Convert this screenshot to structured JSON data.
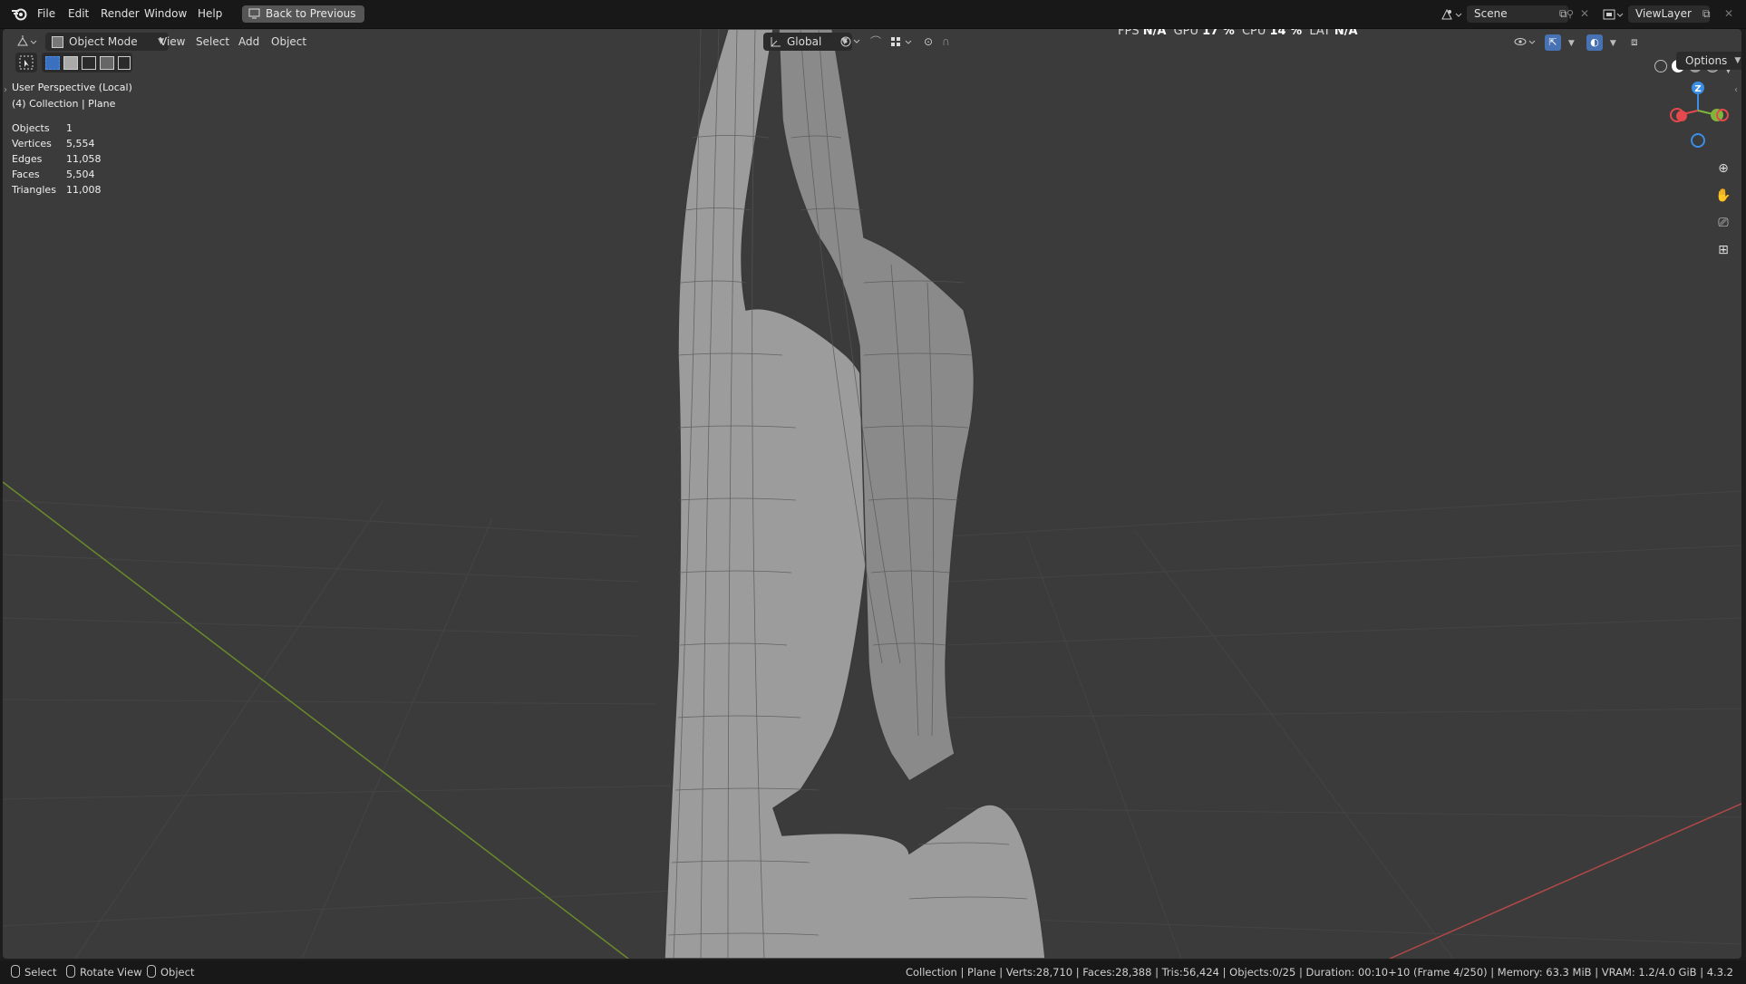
{
  "topbar": {
    "menus": [
      "File",
      "Edit",
      "Render",
      "Window",
      "Help"
    ],
    "back_label": "Back to Previous",
    "scene_value": "Scene",
    "viewlayer_value": "ViewLayer"
  },
  "viewport_header": {
    "mode_label": "Object Mode",
    "menus": [
      "View",
      "Select",
      "Add",
      "Object"
    ],
    "orientation_label": "Global",
    "options_label": "Options"
  },
  "perf": {
    "fps_label": "FPS",
    "fps_value": "N/A",
    "gpu_label": "GPU",
    "gpu_value": "17 %",
    "cpu_label": "CPU",
    "cpu_value": "14 %",
    "lat_label": "LAT",
    "lat_value": "N/A"
  },
  "overlay": {
    "view_name": "User Perspective (Local)",
    "collection": "(4) Collection | Plane",
    "stats": [
      {
        "label": "Objects",
        "value": "1"
      },
      {
        "label": "Vertices",
        "value": "5,554"
      },
      {
        "label": "Edges",
        "value": "11,058"
      },
      {
        "label": "Faces",
        "value": "5,504"
      },
      {
        "label": "Triangles",
        "value": "11,008"
      }
    ]
  },
  "gizmo": {
    "z_label": "Z",
    "x_color": "#e5484d",
    "y_color": "#7fb53b",
    "z_color": "#3a8ee6"
  },
  "statusbar": {
    "select_label": "Select",
    "rotate_label": "Rotate View",
    "object_label": "Object",
    "info": "Collection | Plane | Verts:28,710 | Faces:28,388 | Tris:56,424 | Objects:0/25 | Duration: 00:10+10 (Frame 4/250) | Memory: 63.3 MiB | VRAM: 1.2/4.0 GiB | 4.3.2"
  },
  "colors": {
    "accent": "#4772b3",
    "viewport_bg": "#3b3b3b",
    "mesh": "#9a9a9a",
    "x_axis": "#c44d4d",
    "y_axis": "#7a9a2a"
  }
}
